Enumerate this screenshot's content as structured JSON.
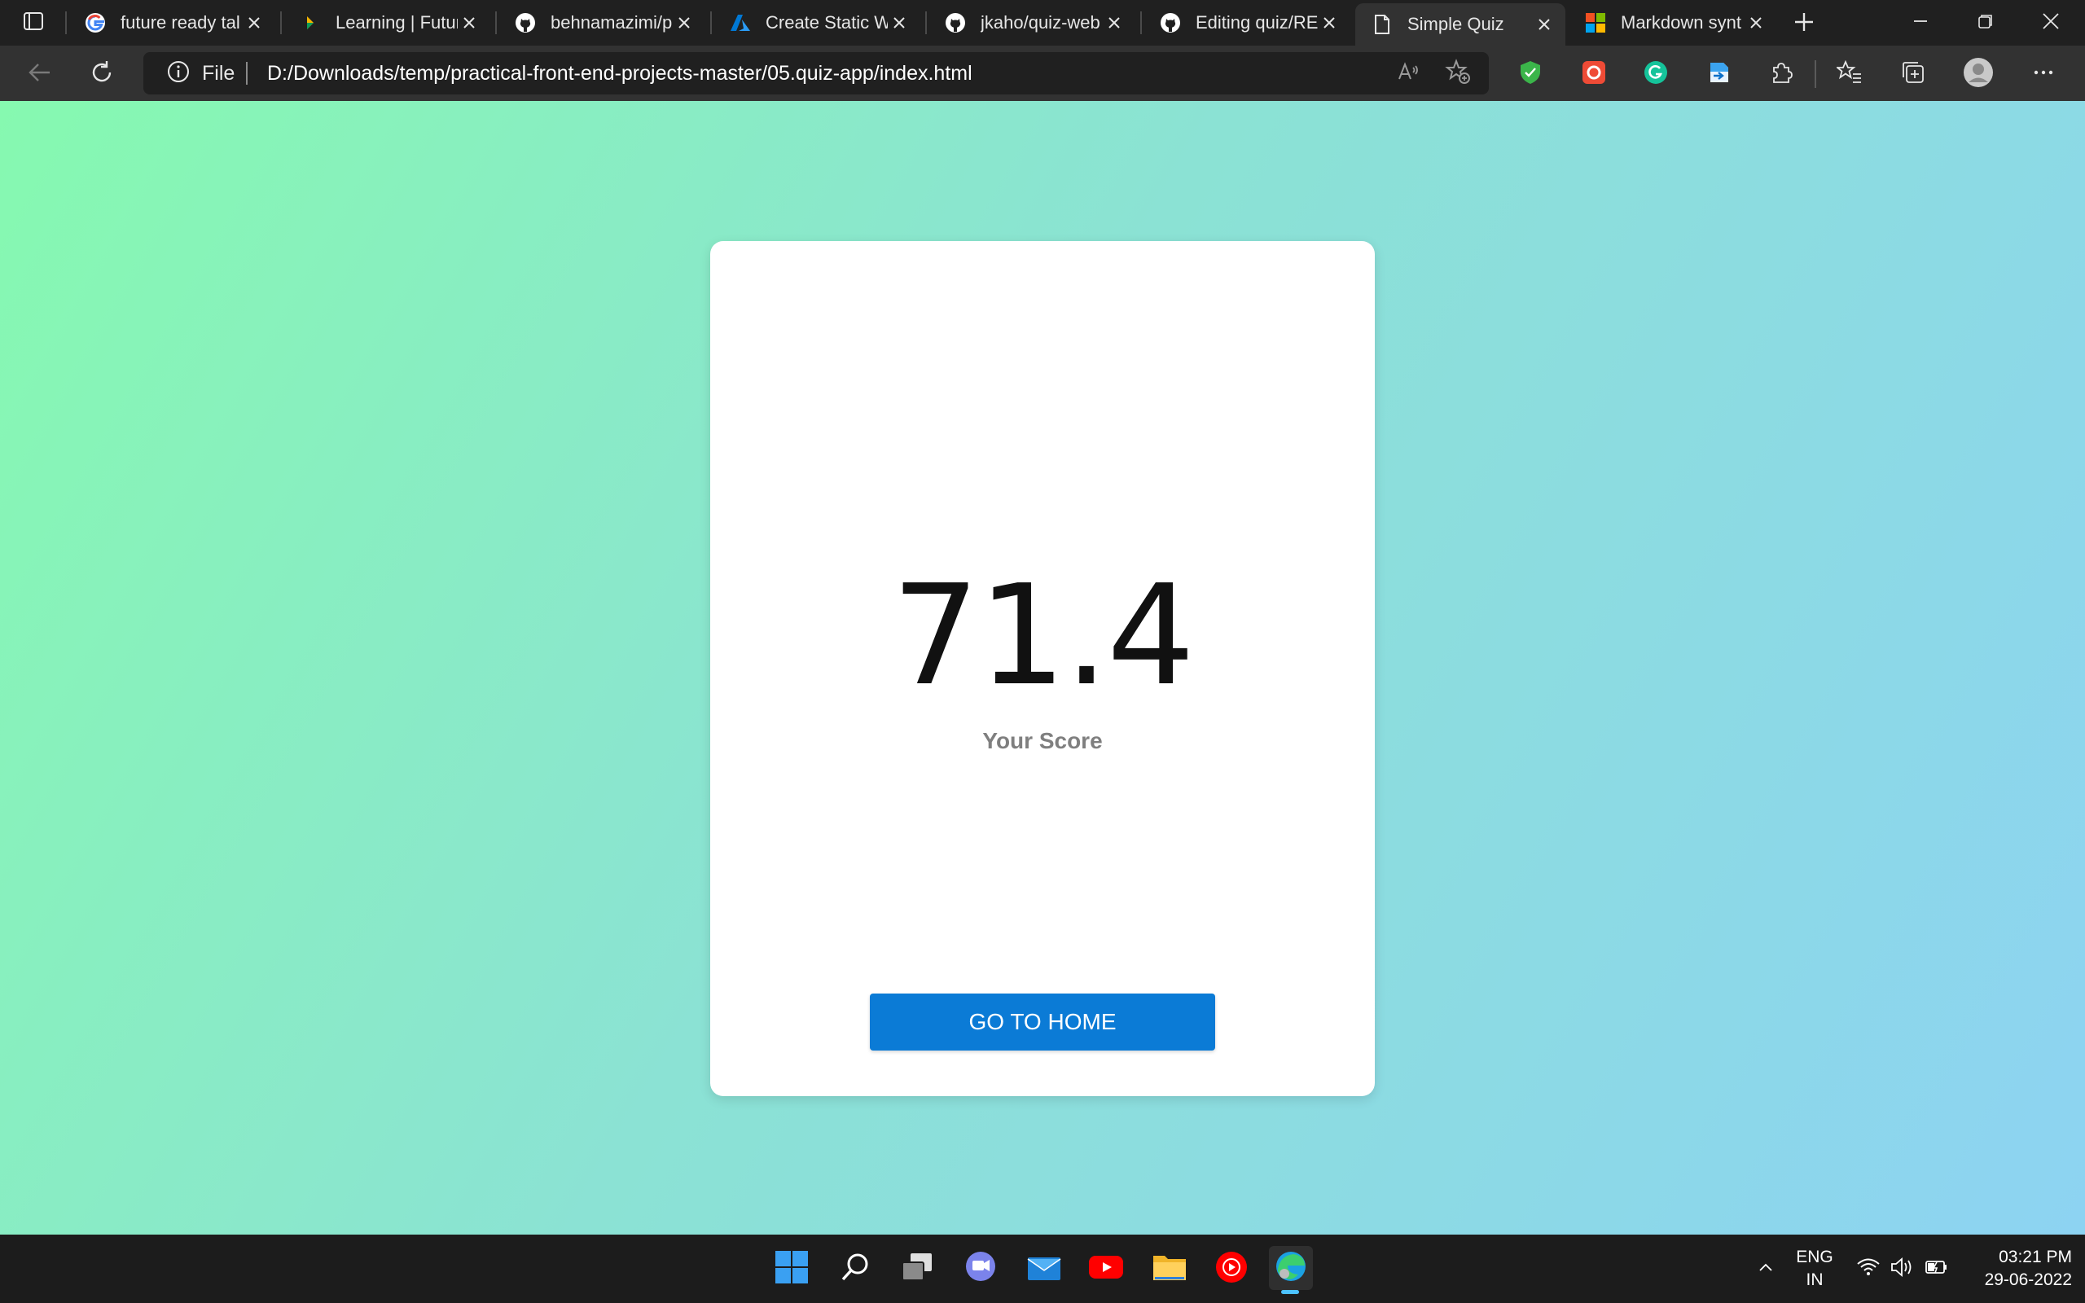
{
  "browser": {
    "tabs": [
      {
        "title": "future ready tal",
        "icon": "google-icon"
      },
      {
        "title": "Learning | Futur",
        "icon": "learning-icon"
      },
      {
        "title": "behnamazimi/p",
        "icon": "github-icon"
      },
      {
        "title": "Create Static W",
        "icon": "azure-icon"
      },
      {
        "title": "jkaho/quiz-web",
        "icon": "github-icon"
      },
      {
        "title": "Editing quiz/RE",
        "icon": "github-icon"
      },
      {
        "title": "Simple Quiz",
        "icon": "page-icon",
        "active": true
      },
      {
        "title": "Markdown synt",
        "icon": "microsoft-icon"
      }
    ],
    "address": {
      "scheme_label": "File",
      "url": "D:/Downloads/temp/practical-front-end-projects-master/05.quiz-app/index.html"
    }
  },
  "quiz": {
    "score": "71.4",
    "score_label": "Your Score",
    "home_button": "GO TO HOME"
  },
  "taskbar": {
    "language_top": "ENG",
    "language_bottom": "IN",
    "time": "03:21 PM",
    "date": "29-06-2022"
  },
  "colors": {
    "page_gradient_start": "#86f9b0",
    "page_gradient_end": "#8dd3f2",
    "button": "#0b7bd6",
    "browser_chrome": "#202020",
    "toolbar": "#323232"
  }
}
